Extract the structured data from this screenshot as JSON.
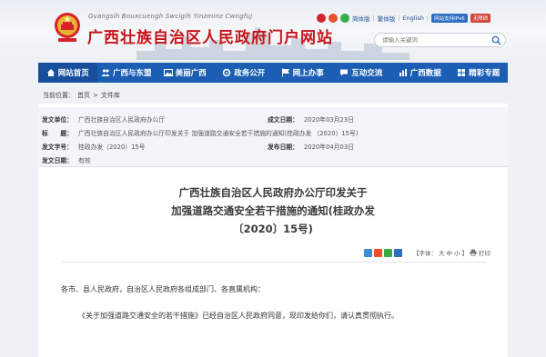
{
  "header": {
    "subtitle": "Gvangsih Bouxcuengh Swcigih Yinzminz Cwngfuj",
    "title": "广西壮族自治区人民政府门户网站",
    "links": {
      "simplified": "简体版",
      "traditional": "繁体版",
      "english": "English",
      "ipv6": "网站支持IPv6",
      "accessible": "无障碍"
    },
    "search_placeholder": "请输入关键词"
  },
  "nav": {
    "items": [
      {
        "label": "网站首页",
        "icon": "home-icon"
      },
      {
        "label": "广西与东盟",
        "icon": "people-icon"
      },
      {
        "label": "美丽广西",
        "icon": "image-icon"
      },
      {
        "label": "政务公开",
        "icon": "gear-icon"
      },
      {
        "label": "网上办事",
        "icon": "flag-icon"
      },
      {
        "label": "互动交流",
        "icon": "chat-icon"
      },
      {
        "label": "广西数据",
        "icon": "chart-icon"
      },
      {
        "label": "精彩专题",
        "icon": "grid-icon"
      }
    ]
  },
  "breadcrumb": {
    "prefix": "当前位置：",
    "home": "首页",
    "separator": ">",
    "current": "文件库"
  },
  "meta": {
    "issuer_label": "发文单位：",
    "issuer": "广西壮族自治区人民政府办公厅",
    "date_label": "成文日期：",
    "date": "2020年03月23日",
    "title_label": "标　　题：",
    "title": "广西壮族自治区人民政府办公厅印发关于 加强道路交通安全若干措施的通知(桂政办发 〔2020〕15号)",
    "docno_label": "发文字号：",
    "docno": "桂政办发〔2020〕15号",
    "pubdate_label": "发布日期：",
    "pubdate": "2020年04月03日",
    "validity_label": "发文日期：",
    "validity": "有效"
  },
  "article": {
    "title_lines": [
      "广西壮族自治区人民政府办公厅印发关于",
      "加强道路交通安全若干措施的通知(桂政办发",
      "〔2020〕15号)"
    ],
    "font_label": "【字体：",
    "font_large": "大",
    "font_medium": "中",
    "font_small": "小",
    "font_end": "】",
    "print_label": "打印",
    "para1": "各市、县人民政府，自治区人民政府各组成部门、各直属机构：",
    "para2": "《关于加强道路交通安全的若干措施》已经自治区人民政府同意，现印发给你们，请认真贯彻执行。"
  },
  "colors": {
    "brand_red": "#c6141a",
    "nav_blue": "#1c5eb4"
  }
}
